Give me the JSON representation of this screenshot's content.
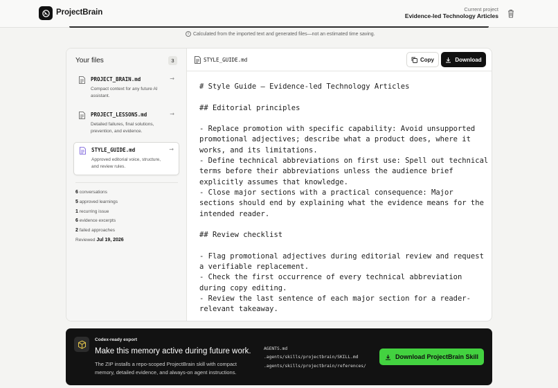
{
  "header": {
    "brand": "ProjectBrain",
    "project_label": "Current project",
    "project_name": "Evidence-led Technology Articles"
  },
  "note": "Calculated from the imported text and generated files—not an estimated time saving.",
  "files": {
    "title": "Your files",
    "count": "3",
    "items": [
      {
        "name": "PROJECT_BRAIN.md",
        "desc": "Compact context for any future AI assistant."
      },
      {
        "name": "PROJECT_LESSONS.md",
        "desc": "Detailed failures, final solutions, prevention, and evidence."
      },
      {
        "name": "STYLE_GUIDE.md",
        "desc": "Approved editorial voice, structure, and review rules."
      }
    ]
  },
  "stats": [
    {
      "value": "6",
      "label": "conversations"
    },
    {
      "value": "5",
      "label": "approved learnings"
    },
    {
      "value": "1",
      "label": "recurring issue"
    },
    {
      "value": "6",
      "label": "evidence excerpts"
    },
    {
      "value": "2",
      "label": "failed approaches"
    }
  ],
  "reviewed": {
    "label": "Reviewed",
    "date": "Jul 19, 2026"
  },
  "viewer": {
    "filename": "STYLE_GUIDE.md",
    "copy_label": "Copy",
    "download_label": "Download",
    "lines": [
      "# Style Guide — Evidence-led Technology Articles",
      "",
      "## Editorial principles",
      "",
      "- Replace promotion with specific capability: Avoid unsupported promotional adjectives; describe what a product does, where it works, and its limitations.",
      "- Define technical abbreviations on first use: Spell out technical terms before their abbreviations unless the audience brief explicitly assumes that knowledge.",
      "- Close major sections with a practical consequence: Major sections should end by explaining what the evidence means for the intended reader.",
      "",
      "## Review checklist",
      "",
      "- Flag promotional adjectives during editorial review and request a verifiable replacement.",
      "- Check the first occurrence of every technical abbreviation during copy editing.",
      "- Review the last sentence of each major section for a reader-relevant takeaway."
    ]
  },
  "export": {
    "kicker": "Codex-ready export",
    "title": "Make this memory active during future work.",
    "text": "The ZIP installs a repo-scoped ProjectBrain skill with compact memory, detailed evidence, and always-on agent instructions.",
    "files": [
      "AGENTS.md",
      ".agents/skills/projectbrain/SKILL.md",
      ".agents/skills/projectbrain/references/"
    ],
    "button_label": "Download ProjectBrain Skill",
    "accent": "#43d240"
  }
}
